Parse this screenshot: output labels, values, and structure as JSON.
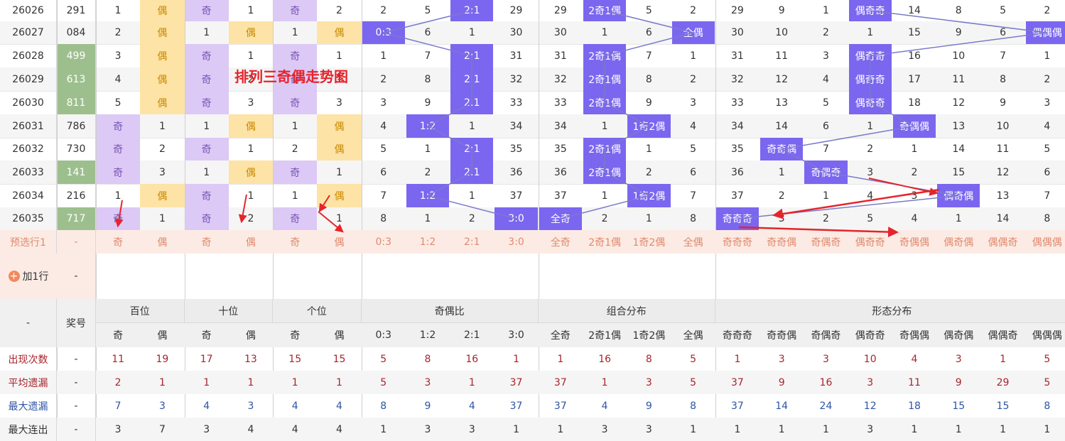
{
  "title": "排列三奇偶走势图",
  "add_row_label": "加1行",
  "dash": "-",
  "colors": {
    "odd": "#dcc9f5",
    "even": "#fde3a6",
    "green": "#9dbf8e",
    "block": "#7b66f0",
    "preselect": "#fcebe4",
    "stat_red": "#a8252c",
    "stat_blue": "#2f55a4"
  },
  "header": {
    "dash": "-",
    "prize": "奖号",
    "groups": [
      "百位",
      "十位",
      "个位",
      "奇偶比",
      "组合分布",
      "形态分布"
    ],
    "sub": [
      "奇",
      "偶",
      "奇",
      "偶",
      "奇",
      "偶",
      "0:3",
      "1:2",
      "2:1",
      "3:0",
      "全奇",
      "2奇1偶",
      "1奇2偶",
      "全偶",
      "奇奇奇",
      "奇奇偶",
      "奇偶奇",
      "偶奇奇",
      "奇偶偶",
      "偶奇偶",
      "偶偶奇",
      "偶偶偶"
    ]
  },
  "rows": [
    {
      "issue": "26026",
      "num": "291",
      "c": [
        "1",
        "偶",
        "奇",
        "1",
        "奇",
        "2",
        "2",
        "5",
        "2:1",
        "29",
        "29",
        "2奇1偶",
        "5",
        "2",
        "29",
        "9",
        "1",
        "偶奇奇",
        "14",
        "8",
        "5",
        "2"
      ]
    },
    {
      "issue": "26027",
      "num": "084",
      "c": [
        "2",
        "偶",
        "1",
        "偶",
        "1",
        "偶",
        "0:3",
        "6",
        "1",
        "30",
        "30",
        "1",
        "6",
        "全偶",
        "30",
        "10",
        "2",
        "1",
        "15",
        "9",
        "6",
        "偶偶偶"
      ]
    },
    {
      "issue": "26028",
      "num": "499",
      "c": [
        "3",
        "偶",
        "奇",
        "1",
        "奇",
        "1",
        "1",
        "7",
        "2:1",
        "31",
        "31",
        "2奇1偶",
        "7",
        "1",
        "31",
        "11",
        "3",
        "偶奇奇",
        "16",
        "10",
        "7",
        "1"
      ]
    },
    {
      "issue": "26029",
      "num": "613",
      "c": [
        "4",
        "偶",
        "奇",
        "2",
        "奇",
        "1",
        "2",
        "8",
        "2:1",
        "32",
        "32",
        "2奇1偶",
        "8",
        "2",
        "32",
        "12",
        "4",
        "偶奇奇",
        "17",
        "11",
        "8",
        "2"
      ]
    },
    {
      "issue": "26030",
      "num": "811",
      "c": [
        "5",
        "偶",
        "奇",
        "3",
        "奇",
        "3",
        "3",
        "9",
        "2:1",
        "33",
        "33",
        "2奇1偶",
        "9",
        "3",
        "33",
        "13",
        "5",
        "偶奇奇",
        "18",
        "12",
        "9",
        "3"
      ]
    },
    {
      "issue": "26031",
      "num": "786",
      "c": [
        "奇",
        "1",
        "1",
        "偶",
        "1",
        "偶",
        "4",
        "1:2",
        "1",
        "34",
        "34",
        "1",
        "1奇2偶",
        "4",
        "34",
        "14",
        "6",
        "1",
        "奇偶偶",
        "13",
        "10",
        "4"
      ]
    },
    {
      "issue": "26032",
      "num": "730",
      "c": [
        "奇",
        "2",
        "奇",
        "1",
        "2",
        "偶",
        "5",
        "1",
        "2:1",
        "35",
        "35",
        "2奇1偶",
        "1",
        "5",
        "35",
        "奇奇偶",
        "7",
        "2",
        "1",
        "14",
        "11",
        "5"
      ]
    },
    {
      "issue": "26033",
      "num": "141",
      "c": [
        "奇",
        "3",
        "1",
        "偶",
        "奇",
        "1",
        "6",
        "2",
        "2:1",
        "36",
        "36",
        "2奇1偶",
        "2",
        "6",
        "36",
        "1",
        "奇偶奇",
        "3",
        "2",
        "15",
        "12",
        "6"
      ]
    },
    {
      "issue": "26034",
      "num": "216",
      "c": [
        "1",
        "偶",
        "奇",
        "1",
        "1",
        "偶",
        "7",
        "1:2",
        "1",
        "37",
        "37",
        "1",
        "1奇2偶",
        "7",
        "37",
        "2",
        "1",
        "4",
        "3",
        "偶奇偶",
        "13",
        "7"
      ]
    },
    {
      "issue": "26035",
      "num": "717",
      "c": [
        "奇",
        "1",
        "奇",
        "2",
        "奇",
        "1",
        "8",
        "1",
        "2",
        "3:0",
        "全奇",
        "2",
        "1",
        "8",
        "奇奇奇",
        "3",
        "2",
        "5",
        "4",
        "1",
        "14",
        "8"
      ]
    }
  ],
  "preselect": {
    "label": "预选行1",
    "num": "-",
    "c": [
      "奇",
      "偶",
      "奇",
      "偶",
      "奇",
      "偶",
      "0:3",
      "1:2",
      "2:1",
      "3:0",
      "全奇",
      "2奇1偶",
      "1奇2偶",
      "全偶",
      "奇奇奇",
      "奇奇偶",
      "奇偶奇",
      "偶奇奇",
      "奇偶偶",
      "偶奇偶",
      "偶偶奇",
      "偶偶偶"
    ]
  },
  "stats": [
    {
      "label": "出现次数",
      "num": "-",
      "v": [
        "11",
        "19",
        "17",
        "13",
        "15",
        "15",
        "5",
        "8",
        "16",
        "1",
        "1",
        "16",
        "8",
        "5",
        "1",
        "3",
        "3",
        "10",
        "4",
        "3",
        "1",
        "5"
      ]
    },
    {
      "label": "平均遗漏",
      "num": "-",
      "v": [
        "2",
        "1",
        "1",
        "1",
        "1",
        "1",
        "5",
        "3",
        "1",
        "37",
        "37",
        "1",
        "3",
        "5",
        "37",
        "9",
        "16",
        "3",
        "11",
        "9",
        "29",
        "5"
      ]
    },
    {
      "label": "最大遗漏",
      "num": "-",
      "v": [
        "7",
        "3",
        "4",
        "3",
        "4",
        "4",
        "8",
        "9",
        "4",
        "37",
        "37",
        "4",
        "9",
        "8",
        "37",
        "14",
        "24",
        "12",
        "18",
        "15",
        "15",
        "8"
      ]
    },
    {
      "label": "最大连出",
      "num": "-",
      "v": [
        "3",
        "7",
        "3",
        "4",
        "4",
        "4",
        "1",
        "3",
        "3",
        "1",
        "1",
        "3",
        "3",
        "1",
        "1",
        "1",
        "1",
        "3",
        "1",
        "1",
        "1",
        "1"
      ]
    }
  ]
}
